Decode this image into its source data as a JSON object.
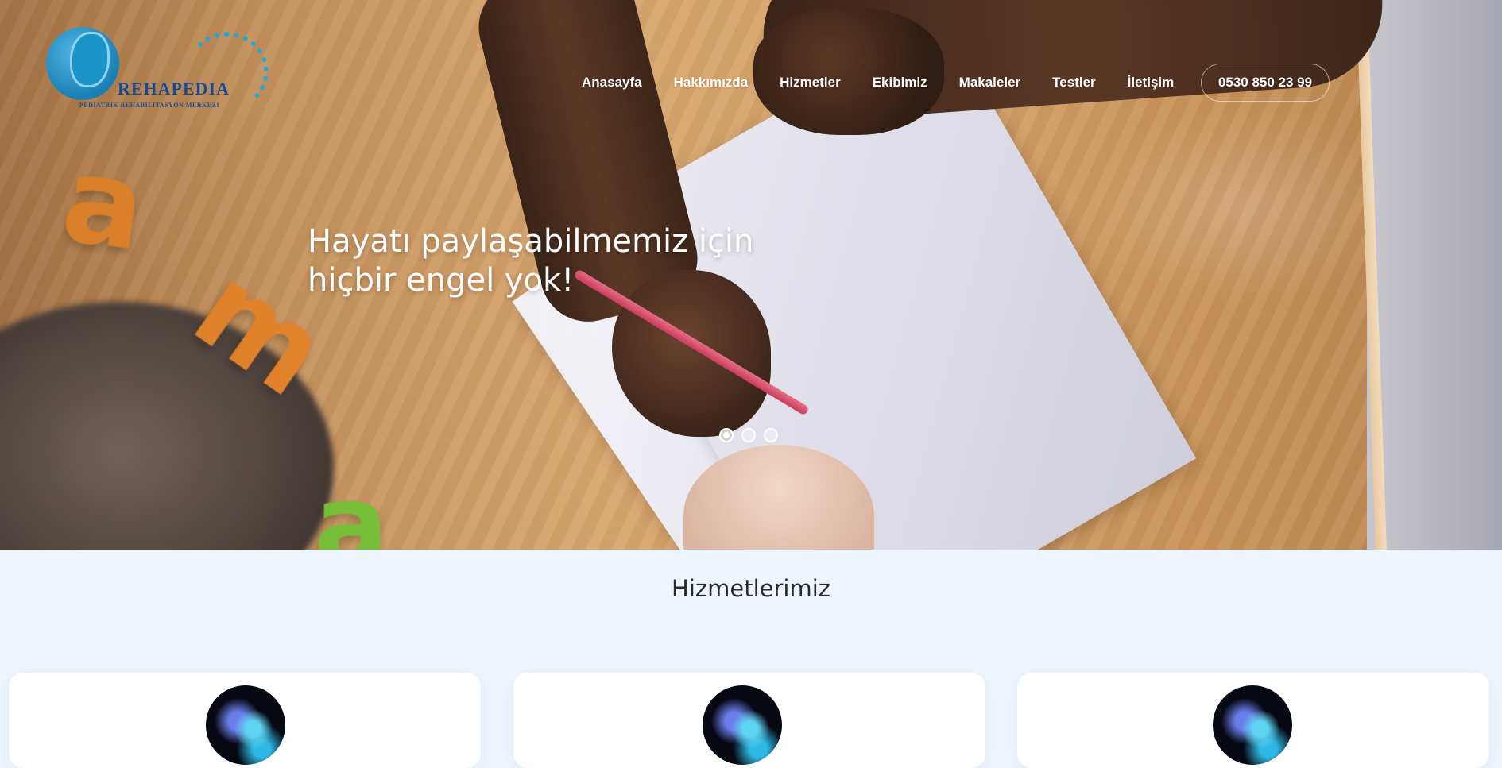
{
  "header": {
    "logo": {
      "brand": "REHAPEDIA",
      "subtitle": "PEDİATRİK REHABİLİTASYON MERKEZİ"
    },
    "nav": [
      {
        "label": "Anasayfa"
      },
      {
        "label": "Hakkımızda"
      },
      {
        "label": "Hizmetler"
      },
      {
        "label": "Ekibimiz"
      },
      {
        "label": "Makaleler"
      },
      {
        "label": "Testler"
      },
      {
        "label": "İletişim"
      }
    ],
    "phone": "0530 850 23 99"
  },
  "hero": {
    "title_line1": "Hayatı paylaşabilmemiz için",
    "title_line2": "hiçbir engel yok!",
    "slides": {
      "count": 3,
      "active": 1
    }
  },
  "services": {
    "title": "Hizmetlerimiz",
    "cards": [
      {
        "icon": "service-image-icon"
      },
      {
        "icon": "service-image-icon"
      },
      {
        "icon": "service-image-icon"
      }
    ]
  },
  "colors": {
    "brand_blue": "#154a9a",
    "accent_cyan": "#2aa6d6",
    "section_bg": "#eef5fd"
  }
}
